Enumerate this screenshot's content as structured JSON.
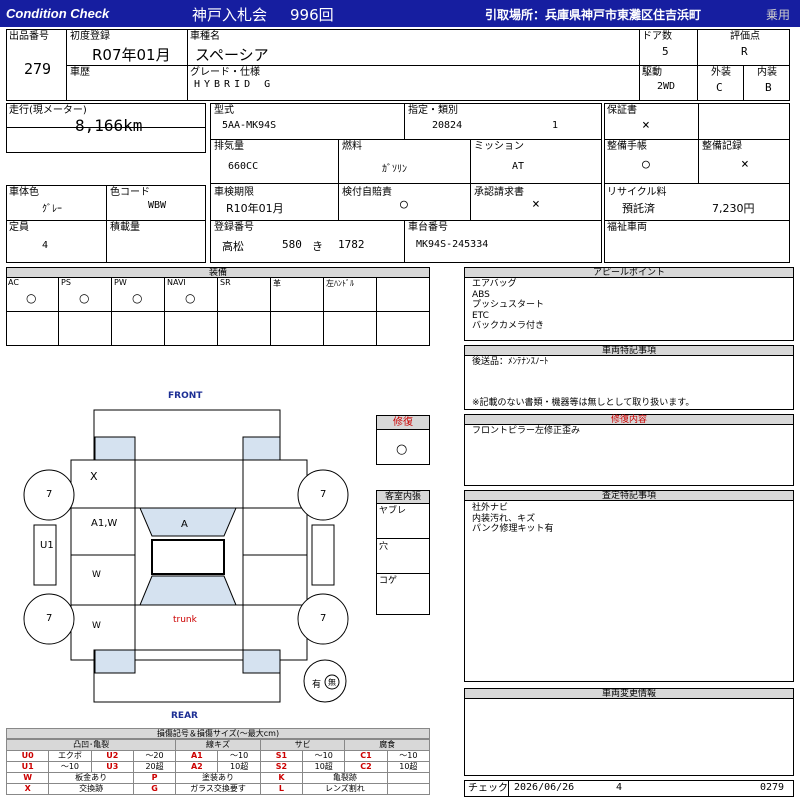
{
  "header": {
    "title_left": "Condition Check",
    "auction": "神戸入札会",
    "sale_no": "996回",
    "pickup": "引取場所：兵庫県神戸市東灘区住吉浜町",
    "category": "乗用"
  },
  "basic": {
    "lot_label": "出品番号",
    "lot": "279",
    "first_reg_label": "初度登録",
    "first_reg": "R07年01月",
    "car_name_label": "車種名",
    "car_name": "スペーシア",
    "doors_label": "ドア数",
    "doors": "5",
    "score_label": "評価点",
    "score": "R",
    "history_label": "車歴",
    "grade_label": "グレード・仕様",
    "grade": "HYBRID G",
    "drive_label": "駆動",
    "drive": "2WD",
    "ext_label": "外装",
    "ext": "C",
    "int_label": "内装",
    "int": "B"
  },
  "specs": {
    "mileage_label": "走行(現メーター)",
    "mileage": "8,166km",
    "model_label": "型式",
    "model": "5AA-MK94S",
    "designation_label": "指定・類別",
    "designation": "20824",
    "category_no": "1",
    "warranty_label": "保証書",
    "warranty": "×",
    "displacement_label": "排気量",
    "displacement": "660CC",
    "fuel_label": "燃料",
    "fuel": "ｶﾞｿﾘﾝ",
    "mission_label": "ミッション",
    "mission": "AT",
    "manual_label": "整備手帳",
    "manual": "○",
    "record_label": "整備記録",
    "record": "×",
    "color_label": "車体色",
    "color": "ｸﾞﾚｰ",
    "color_code_label": "色コード",
    "color_code": "WBW",
    "inspection_label": "車検期限",
    "inspection": "R10年01月",
    "insurance_label": "検付自賠責",
    "insurance": "○",
    "approval_label": "承認請求書",
    "approval": "×",
    "recycle_label": "リサイクル料",
    "recycle_status": "預託済",
    "recycle_fee": "7,230円",
    "capacity_label": "定員",
    "capacity": "4",
    "load_label": "積載量",
    "plate_label": "登録番号",
    "plate_area": "高松",
    "plate_class": "580",
    "plate_kana": "き",
    "plate_no": "1782",
    "chassis_label": "車台番号",
    "chassis": "MK94S-245334",
    "welfare_label": "福祉車両"
  },
  "equipment": {
    "title": "装備",
    "items": [
      {
        "name": "AC",
        "val": "○"
      },
      {
        "name": "PS",
        "val": "○"
      },
      {
        "name": "PW",
        "val": "○"
      },
      {
        "name": "NAVI",
        "val": "○"
      },
      {
        "name": "SR",
        "val": ""
      },
      {
        "name": "革",
        "val": ""
      },
      {
        "name": "左ﾊﾝﾄﾞﾙ",
        "val": ""
      }
    ]
  },
  "diagram": {
    "front": "FRONT",
    "rear": "REAR",
    "trunk": "trunk",
    "marks": {
      "x": "X",
      "a1w": "A1,W",
      "a": "A",
      "w1": "W",
      "w2": "W",
      "u1": "U1"
    },
    "tires": [
      "7",
      "7",
      "7",
      "7"
    ],
    "spare": "有",
    "spare_mark": "無"
  },
  "repair": {
    "label": "修復",
    "val": "○"
  },
  "interior": {
    "title": "客室内張",
    "items": [
      "ヤブレ",
      "穴",
      "コゲ"
    ]
  },
  "appeal": {
    "title": "アピールポイント",
    "lines": [
      "エアバッグ",
      "ABS",
      "プッシュスタート",
      "ETC",
      "バックカメラ付き"
    ]
  },
  "notes": {
    "title": "車両特記事項",
    "line1": "後送品：ﾒﾝﾃﾅﾝｽﾉｰﾄ",
    "line2": "※記載のない書類・機器等は無しとして取り扱います。"
  },
  "repair_detail": {
    "title": "修復内容",
    "line": "フロントピラー左修正歪み"
  },
  "assessment": {
    "title": "査定特記事項",
    "lines": [
      "社外ナビ",
      "内装汚れ、キズ",
      "パンク修理キット有"
    ]
  },
  "changes": {
    "title": "車両変更情報"
  },
  "legend": {
    "title": "損傷記号＆損傷サイズ(〜最大cm)",
    "headers": [
      "凸凹･亀裂",
      "線キズ",
      "サビ",
      "腐食"
    ],
    "row1": [
      [
        "U0",
        "エクボ"
      ],
      [
        "U2",
        "〜20"
      ],
      [
        "A1",
        "〜10"
      ],
      [
        "S1",
        "〜10"
      ],
      [
        "C1",
        "〜10"
      ]
    ],
    "row2": [
      [
        "U1",
        "〜10"
      ],
      [
        "U3",
        "20超"
      ],
      [
        "A2",
        "10超"
      ],
      [
        "S2",
        "10超"
      ],
      [
        "C2",
        "10超"
      ]
    ],
    "row3": [
      [
        "W",
        "板金あり"
      ],
      [
        "P",
        "塗装あり"
      ],
      [
        "K",
        "亀裂跡"
      ]
    ],
    "row4": [
      [
        "X",
        "交換跡"
      ],
      [
        "G",
        "ガラス交換要す"
      ],
      [
        "L",
        "レンズ割れ"
      ]
    ]
  },
  "footer": {
    "check_label": "チェック",
    "date": "2026/06/26",
    "num": "4",
    "code": "0279"
  }
}
